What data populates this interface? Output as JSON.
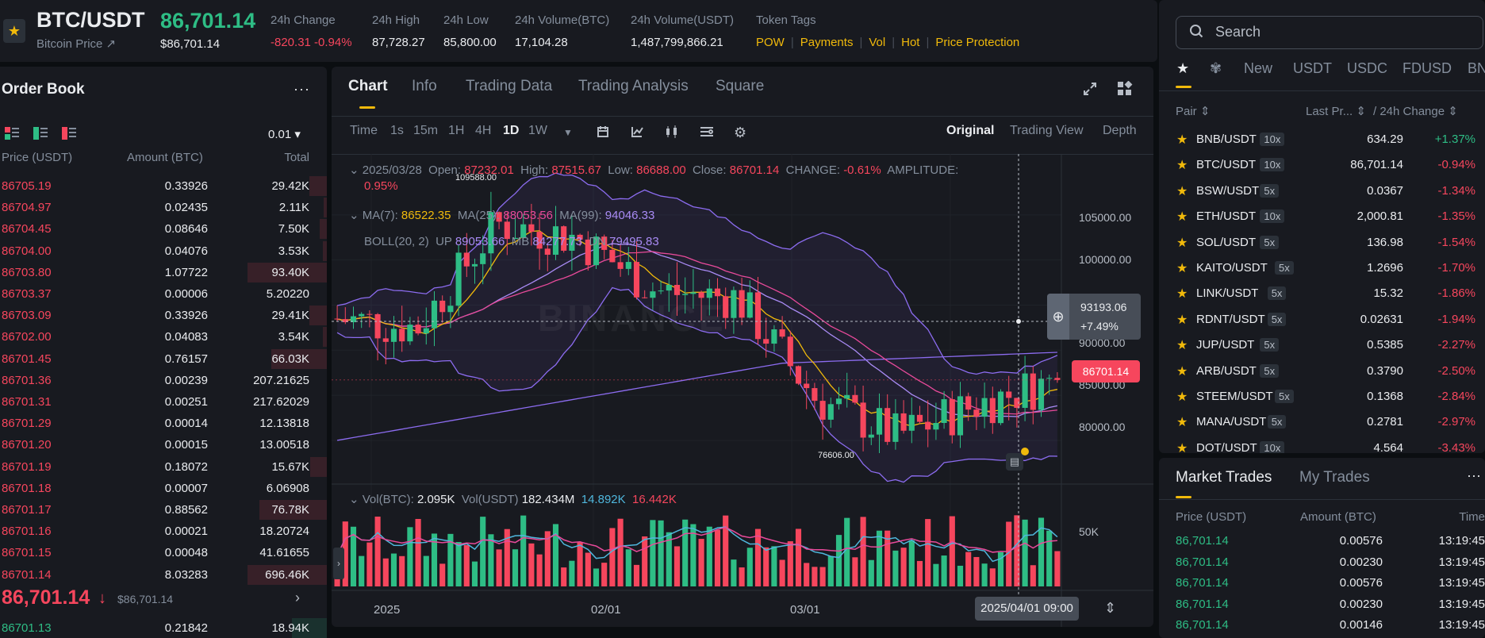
{
  "header": {
    "pair": "BTC/USDT",
    "subtitle": "Bitcoin Price ↗",
    "last_price": "86,701.14",
    "last_price_usd": "$86,701.14",
    "stats": [
      {
        "label": "24h Change",
        "value": "-820.31 -0.94%",
        "color": "#f6465d"
      },
      {
        "label": "24h High",
        "value": "87,728.27",
        "color": "#eaecef"
      },
      {
        "label": "24h Low",
        "value": "85,800.00",
        "color": "#eaecef"
      },
      {
        "label": "24h Volume(BTC)",
        "value": "17,104.28",
        "color": "#eaecef"
      },
      {
        "label": "24h Volume(USDT)",
        "value": "1,487,799,866.21",
        "color": "#eaecef"
      }
    ],
    "tags_label": "Token Tags",
    "tags": [
      "POW",
      "Payments",
      "Vol",
      "Hot",
      "Price Protection"
    ]
  },
  "orderbook": {
    "title": "Order Book",
    "more": "···",
    "precision": "0.01 ▾",
    "headers": {
      "price": "Price (USDT)",
      "amount": "Amount (BTC)",
      "total": "Total"
    },
    "asks": [
      {
        "price": "86705.19",
        "amount": "0.33926",
        "total": "29.42K",
        "depth": 0.22
      },
      {
        "price": "86704.97",
        "amount": "0.02435",
        "total": "2.11K",
        "depth": 0.04
      },
      {
        "price": "86704.45",
        "amount": "0.08646",
        "total": "7.50K",
        "depth": 0.09
      },
      {
        "price": "86704.00",
        "amount": "0.04076",
        "total": "3.53K",
        "depth": 0.05
      },
      {
        "price": "86703.80",
        "amount": "1.07722",
        "total": "93.40K",
        "depth": 1.0
      },
      {
        "price": "86703.37",
        "amount": "0.00006",
        "total": "5.20220",
        "depth": 0.0
      },
      {
        "price": "86703.09",
        "amount": "0.33926",
        "total": "29.41K",
        "depth": 0.22
      },
      {
        "price": "86702.00",
        "amount": "0.04083",
        "total": "3.54K",
        "depth": 0.05
      },
      {
        "price": "86701.45",
        "amount": "0.76157",
        "total": "66.03K",
        "depth": 0.7
      },
      {
        "price": "86701.36",
        "amount": "0.00239",
        "total": "207.21625",
        "depth": 0.0
      },
      {
        "price": "86701.31",
        "amount": "0.00251",
        "total": "217.62029",
        "depth": 0.0
      },
      {
        "price": "86701.29",
        "amount": "0.00014",
        "total": "12.13818",
        "depth": 0.0
      },
      {
        "price": "86701.20",
        "amount": "0.00015",
        "total": "13.00518",
        "depth": 0.0
      },
      {
        "price": "86701.19",
        "amount": "0.18072",
        "total": "15.67K",
        "depth": 0.21
      },
      {
        "price": "86701.18",
        "amount": "0.00007",
        "total": "6.06908",
        "depth": 0.0
      },
      {
        "price": "86701.17",
        "amount": "0.88562",
        "total": "76.78K",
        "depth": 0.85
      },
      {
        "price": "86701.16",
        "amount": "0.00021",
        "total": "18.20724",
        "depth": 0.0
      },
      {
        "price": "86701.15",
        "amount": "0.00048",
        "total": "41.61655",
        "depth": 0.0
      },
      {
        "price": "86701.14",
        "amount": "8.03283",
        "total": "696.46K",
        "depth": 1.0
      }
    ],
    "mid_price": "86,701.14",
    "mid_arrow": "↓",
    "mid_usd": "$86,701.14",
    "bids": [
      {
        "price": "86701.13",
        "amount": "0.21842",
        "total": "18.94K",
        "depth": 0.24
      }
    ]
  },
  "chart": {
    "tabs": [
      "Chart",
      "Info",
      "Trading Data",
      "Trading Analysis",
      "Square"
    ],
    "intervals": [
      "Time",
      "1s",
      "15m",
      "1H",
      "4H",
      "1D",
      "1W"
    ],
    "active_interval": "1D",
    "views": [
      "Original",
      "Trading View",
      "Depth"
    ],
    "ohlc": {
      "date": "2025/03/28",
      "open_label": "Open:",
      "open": "87232.01",
      "high_label": "High:",
      "high": "87515.67",
      "low_label": "Low:",
      "low": "86688.00",
      "close_label": "Close:",
      "close": "86701.14",
      "change_label": "CHANGE:",
      "change": "-0.61%",
      "amp_label": "AMPLITUDE:",
      "amplitude": "0.95%"
    },
    "ma": {
      "ma7_label": "MA(7):",
      "ma7": "86522.35",
      "ma25_label": "MA(25):",
      "ma25": "88053.56",
      "ma99_label": "MA(99):",
      "ma99": "94046.33"
    },
    "boll": {
      "label": "BOLL(20, 2)",
      "up_label": "UP",
      "up": "89053.66",
      "mb_label": "MB",
      "mb": "84277.73",
      "dn_label": "DN",
      "dn": "79495.83"
    },
    "vol": {
      "label": "Vol(BTC):",
      "btc": "2.095K",
      "usdt_label": "Vol(USDT)",
      "usdt": "182.434M",
      "ma5": "14.892K",
      "ma10": "16.442K"
    },
    "watermark": "BINANCE",
    "price_axis": [
      "105000.00",
      "100000.00",
      "95000.00",
      "90000.00",
      "85000.00",
      "80000.00"
    ],
    "vol_axis": "50K",
    "high_marker": "109588.00",
    "low_marker": "76606.00",
    "cross_price": "93193.06",
    "cross_pct": "+7.49%",
    "last_label": "86701.14",
    "x_labels": [
      "2025",
      "02/01",
      "03/01"
    ],
    "cross_time": "2025/04/01 09:00",
    "colors": {
      "up": "#2ebd85",
      "down": "#f6465d",
      "ma7": "#f0b90b",
      "ma25": "#e84a9a",
      "ma99": "#8c6cf0"
    }
  },
  "chart_data": {
    "type": "candlestick",
    "x": [
      "2024-12-30",
      "2025-01-09",
      "2025-01-19",
      "2025-01-29",
      "2025-02-08",
      "2025-02-18",
      "2025-02-28",
      "2025-03-10",
      "2025-03-20",
      "2025-03-28"
    ],
    "close": [
      93500,
      92500,
      104000,
      102500,
      96500,
      95800,
      84500,
      80500,
      84000,
      86701.14
    ],
    "ylim": [
      76000,
      110000
    ],
    "high": 109588.0,
    "low": 76606.0
  },
  "market": {
    "search_placeholder": "Search",
    "tabs": [
      "New",
      "USDT",
      "USDC",
      "FDUSD",
      "BN"
    ],
    "headers": {
      "pair": "Pair ⇕",
      "last": "Last Pr... ⇕",
      "change": "/ 24h Change ⇕"
    },
    "rows": [
      {
        "pair": "BNB/USDT",
        "lev": "10x",
        "price": "634.29",
        "change": "+1.37%",
        "up": true
      },
      {
        "pair": "BTC/USDT",
        "lev": "10x",
        "price": "86,701.14",
        "change": "-0.94%",
        "up": false
      },
      {
        "pair": "BSW/USDT",
        "lev": "5x",
        "price": "0.0367",
        "change": "-1.34%",
        "up": false
      },
      {
        "pair": "ETH/USDT",
        "lev": "10x",
        "price": "2,000.81",
        "change": "-1.35%",
        "up": false
      },
      {
        "pair": "SOL/USDT",
        "lev": "5x",
        "price": "136.98",
        "change": "-1.54%",
        "up": false
      },
      {
        "pair": "KAITO/USDT",
        "lev": "5x",
        "price": "1.2696",
        "change": "-1.70%",
        "up": false
      },
      {
        "pair": "LINK/USDT",
        "lev": "5x",
        "price": "15.32",
        "change": "-1.86%",
        "up": false
      },
      {
        "pair": "RDNT/USDT",
        "lev": "5x",
        "price": "0.02631",
        "change": "-1.94%",
        "up": false
      },
      {
        "pair": "JUP/USDT",
        "lev": "5x",
        "price": "0.5385",
        "change": "-2.27%",
        "up": false
      },
      {
        "pair": "ARB/USDT",
        "lev": "5x",
        "price": "0.3790",
        "change": "-2.50%",
        "up": false
      },
      {
        "pair": "STEEM/USDT",
        "lev": "5x",
        "price": "0.1368",
        "change": "-2.84%",
        "up": false
      },
      {
        "pair": "MANA/USDT",
        "lev": "5x",
        "price": "0.2781",
        "change": "-2.97%",
        "up": false
      },
      {
        "pair": "DOT/USDT",
        "lev": "10x",
        "price": "4.564",
        "change": "-3.43%",
        "up": false
      }
    ]
  },
  "trades": {
    "tabs": [
      "Market Trades",
      "My Trades"
    ],
    "more": "···",
    "headers": {
      "price": "Price (USDT)",
      "amount": "Amount (BTC)",
      "time": "Time"
    },
    "rows": [
      {
        "price": "86,701.14",
        "amount": "0.00576",
        "time": "13:19:45"
      },
      {
        "price": "86,701.14",
        "amount": "0.00230",
        "time": "13:19:45"
      },
      {
        "price": "86,701.14",
        "amount": "0.00576",
        "time": "13:19:45"
      },
      {
        "price": "86,701.14",
        "amount": "0.00230",
        "time": "13:19:45"
      },
      {
        "price": "86,701.14",
        "amount": "0.00146",
        "time": "13:19:45"
      }
    ]
  }
}
